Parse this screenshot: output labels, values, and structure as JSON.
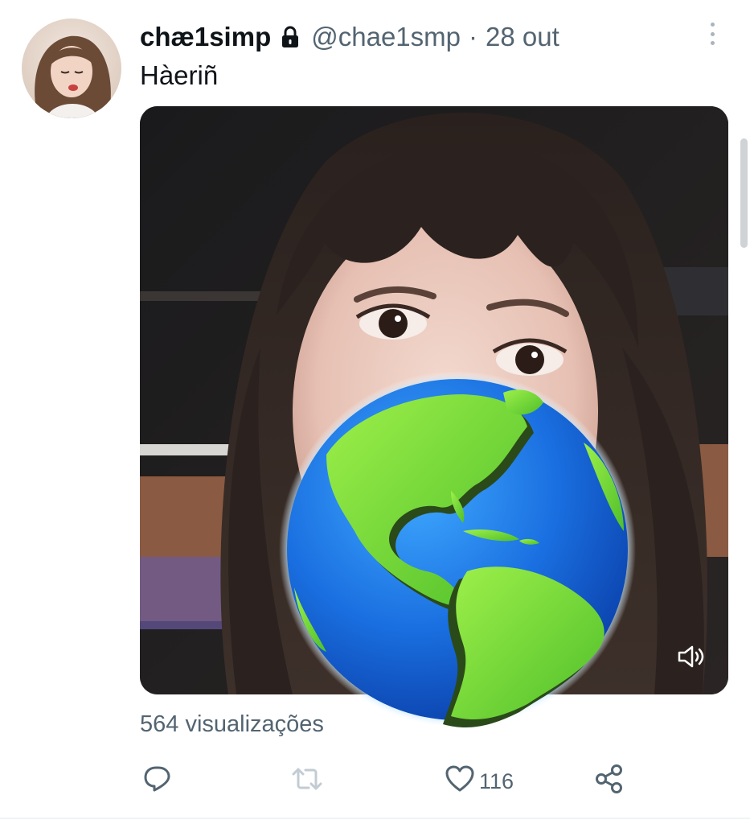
{
  "author": {
    "display_name": "chæ1simp",
    "handle": "@chae1smp",
    "separator": "·",
    "date": "28 out"
  },
  "tweet": {
    "text": "Hàeriñ"
  },
  "media": {
    "type": "video",
    "overlay_emoji": "globe-showing-americas"
  },
  "stats": {
    "views": "564 visualizações",
    "likes": "116"
  },
  "icons": {
    "lock": "lock-icon",
    "more": "more-icon",
    "reply": "reply-icon",
    "retweet": "retweet-icon",
    "like": "heart-icon",
    "share": "share-icon",
    "volume": "volume-icon"
  },
  "colors": {
    "text_primary": "#0f1419",
    "text_secondary": "#536471",
    "retweet_disabled": "#c3ccd3"
  }
}
